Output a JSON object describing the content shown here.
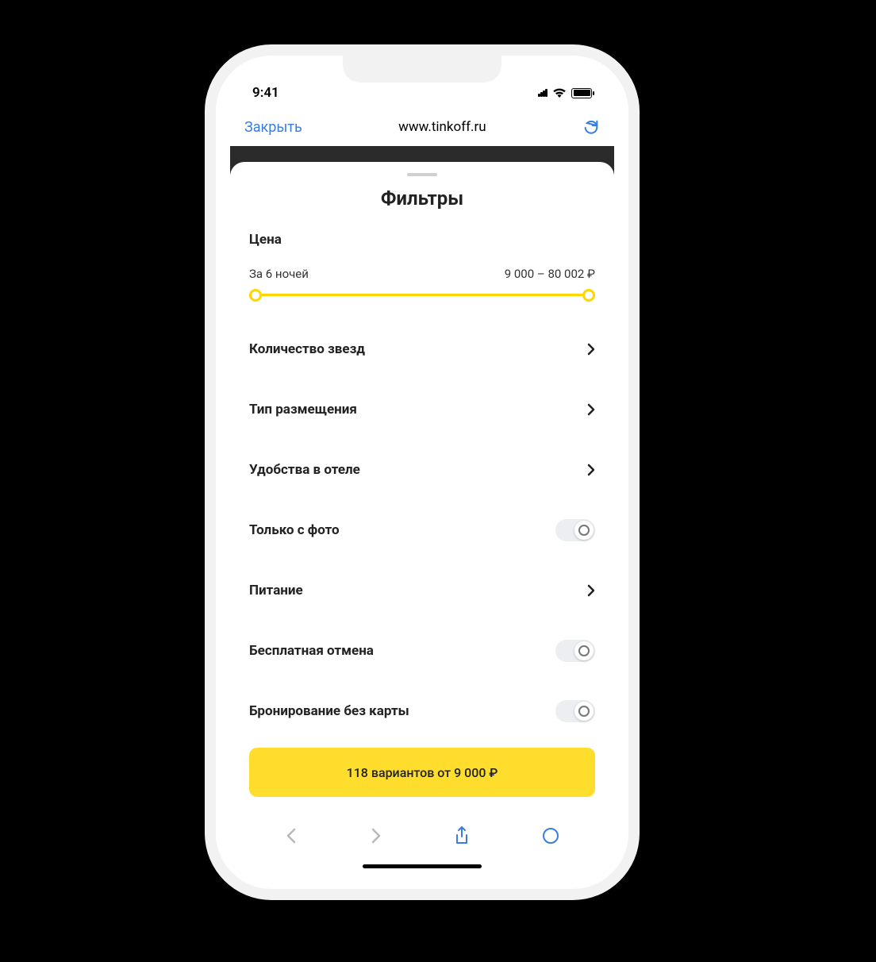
{
  "status": {
    "time": "9:41"
  },
  "nav": {
    "close": "Закрыть",
    "url": "www.tinkoff.ru"
  },
  "sheet": {
    "title": "Фильтры",
    "price": {
      "label": "Цена",
      "nights": "За 6 ночей",
      "range": "9 000 – 80 002 ₽"
    },
    "filters": {
      "stars": "Количество звезд",
      "accommodation": "Тип размещения",
      "amenities": "Удобства в отеле",
      "photo_only": "Только с фото",
      "meals": "Питание",
      "free_cancel": "Бесплатная отмена",
      "no_card": "Бронирование без карты"
    },
    "results_button": "118 вариантов от 9 000 ₽"
  }
}
